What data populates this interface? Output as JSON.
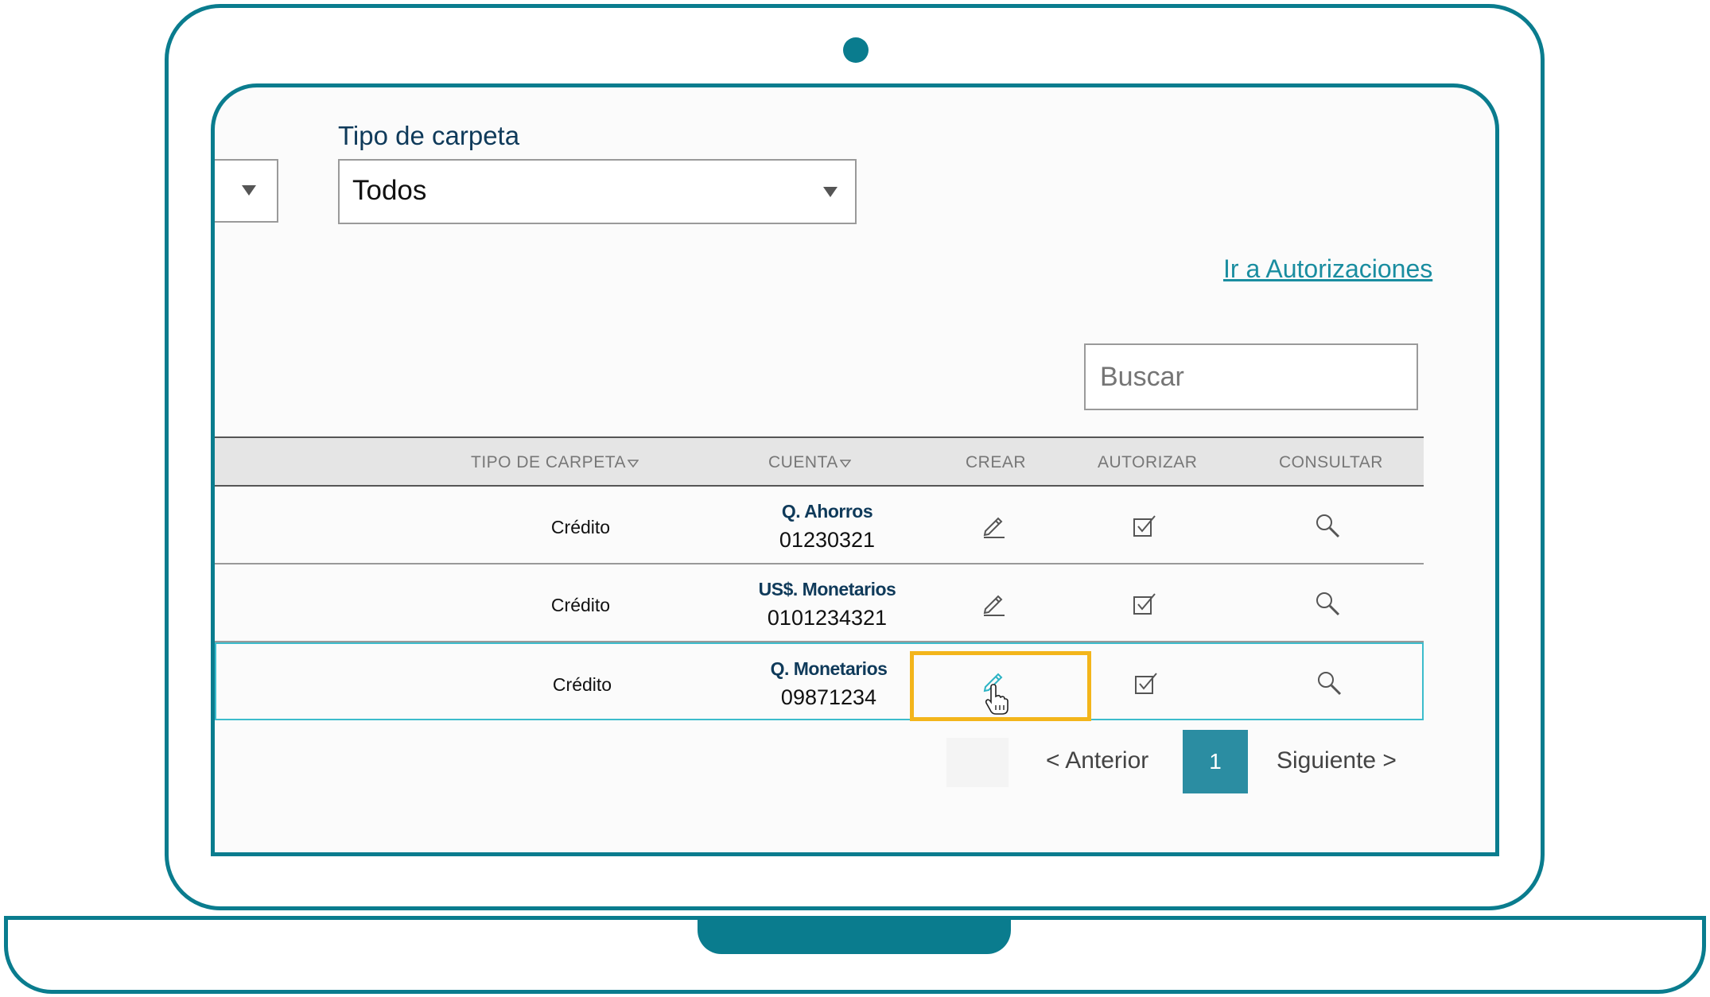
{
  "filters": {
    "folder_type_label": "Tipo de carpeta",
    "folder_type_value": "Todos"
  },
  "links": {
    "authorizations": "Ir a Autorizaciones"
  },
  "search": {
    "placeholder": "Buscar"
  },
  "table": {
    "headers": {
      "tipo": "TIPO DE CARPETA",
      "cuenta": "CUENTA",
      "crear": "CREAR",
      "autorizar": "AUTORIZAR",
      "consultar": "CONSULTAR"
    },
    "rows": [
      {
        "tipo": "Crédito",
        "account_name": "Q. Ahorros",
        "account_number": "01230321"
      },
      {
        "tipo": "Crédito",
        "account_name": "US$. Monetarios",
        "account_number": "0101234321"
      },
      {
        "tipo": "Crédito",
        "account_name": "Q. Monetarios",
        "account_number": "09871234"
      }
    ],
    "icons": {
      "crear": "pencil-icon",
      "autorizar": "checkbox-icon",
      "consultar": "magnifier-icon"
    }
  },
  "pagination": {
    "prev": "< Anterior",
    "current": "1",
    "next": "Siguiente >"
  },
  "colors": {
    "frame": "#0a7c8e",
    "accent": "#2b8da2",
    "highlight": "#f3b51b",
    "active_row_border": "#3cbccc"
  }
}
